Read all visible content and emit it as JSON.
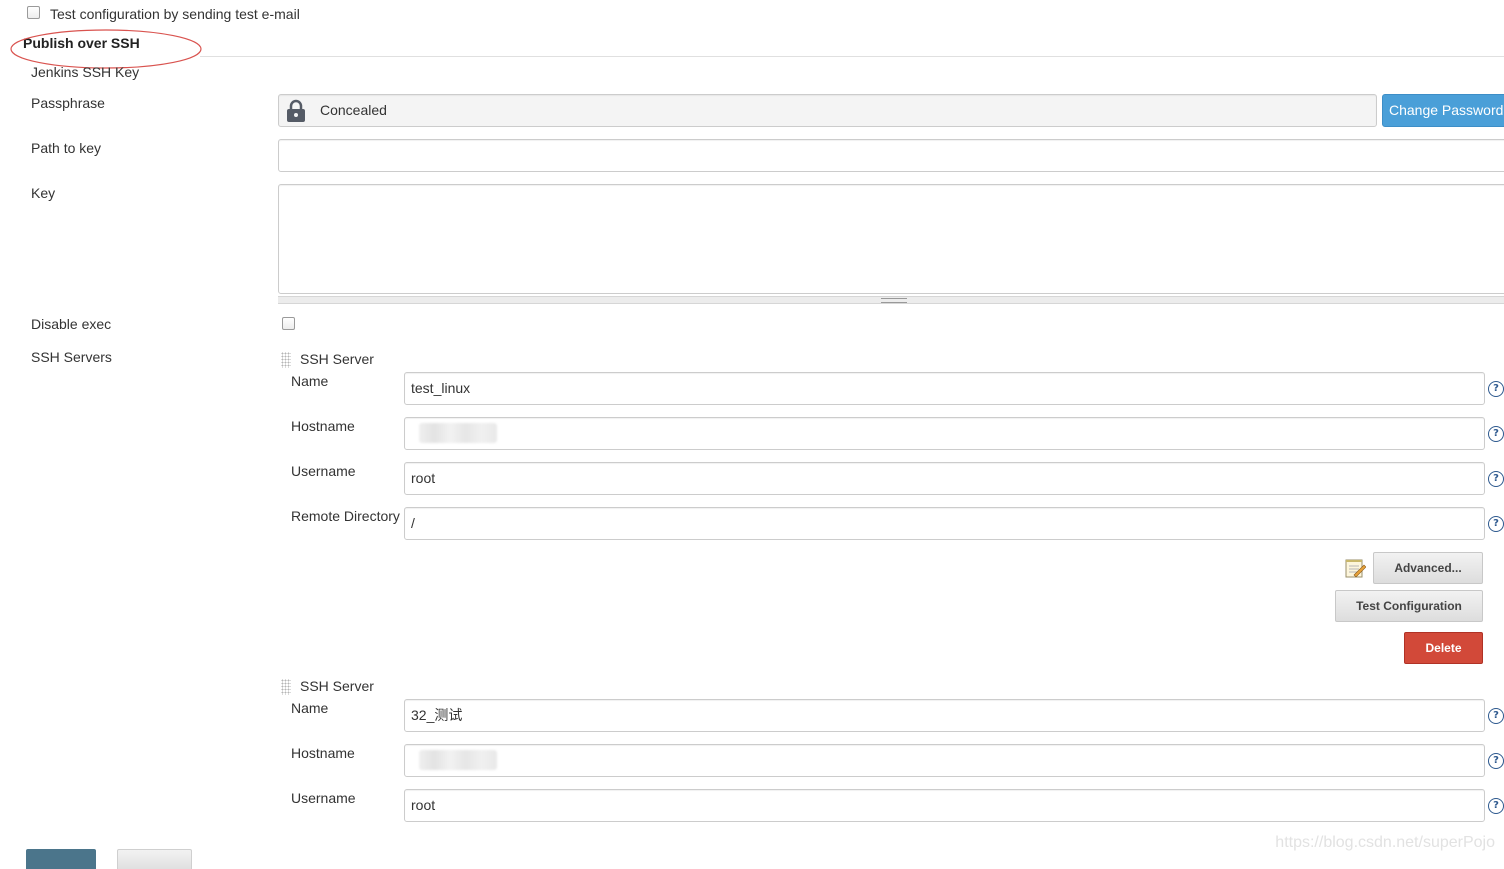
{
  "email_test": {
    "checkbox_label": "Test configuration by sending test e-mail"
  },
  "section": {
    "title": "Publish over SSH",
    "highlight_color": "#d9534f"
  },
  "form": {
    "jenkins_ssh_key_label": "Jenkins SSH Key",
    "passphrase_label": "Passphrase",
    "passphrase_value": "Concealed",
    "change_password_button": "Change Password",
    "path_to_key_label": "Path to key",
    "path_to_key_value": "",
    "key_label": "Key",
    "key_value": "",
    "disable_exec_label": "Disable exec",
    "ssh_servers_label": "SSH Servers"
  },
  "servers": [
    {
      "header": "SSH Server",
      "name_label": "Name",
      "name_value": "test_linux",
      "hostname_label": "Hostname",
      "username_label": "Username",
      "username_value": "root",
      "remote_dir_label": "Remote Directory",
      "remote_dir_value": "/",
      "advanced_button": "Advanced...",
      "test_button": "Test Configuration",
      "delete_button": "Delete"
    },
    {
      "header": "SSH Server",
      "name_label": "Name",
      "name_value": "32_测试",
      "hostname_label": "Hostname",
      "username_label": "Username",
      "username_value": "root"
    }
  ],
  "help_icon_glyph": "?",
  "watermark": "https://blog.csdn.net/superPojo",
  "colors": {
    "primary_button": "#4a9fd8",
    "delete_button": "#d24939",
    "save_button": "#4b758b"
  }
}
